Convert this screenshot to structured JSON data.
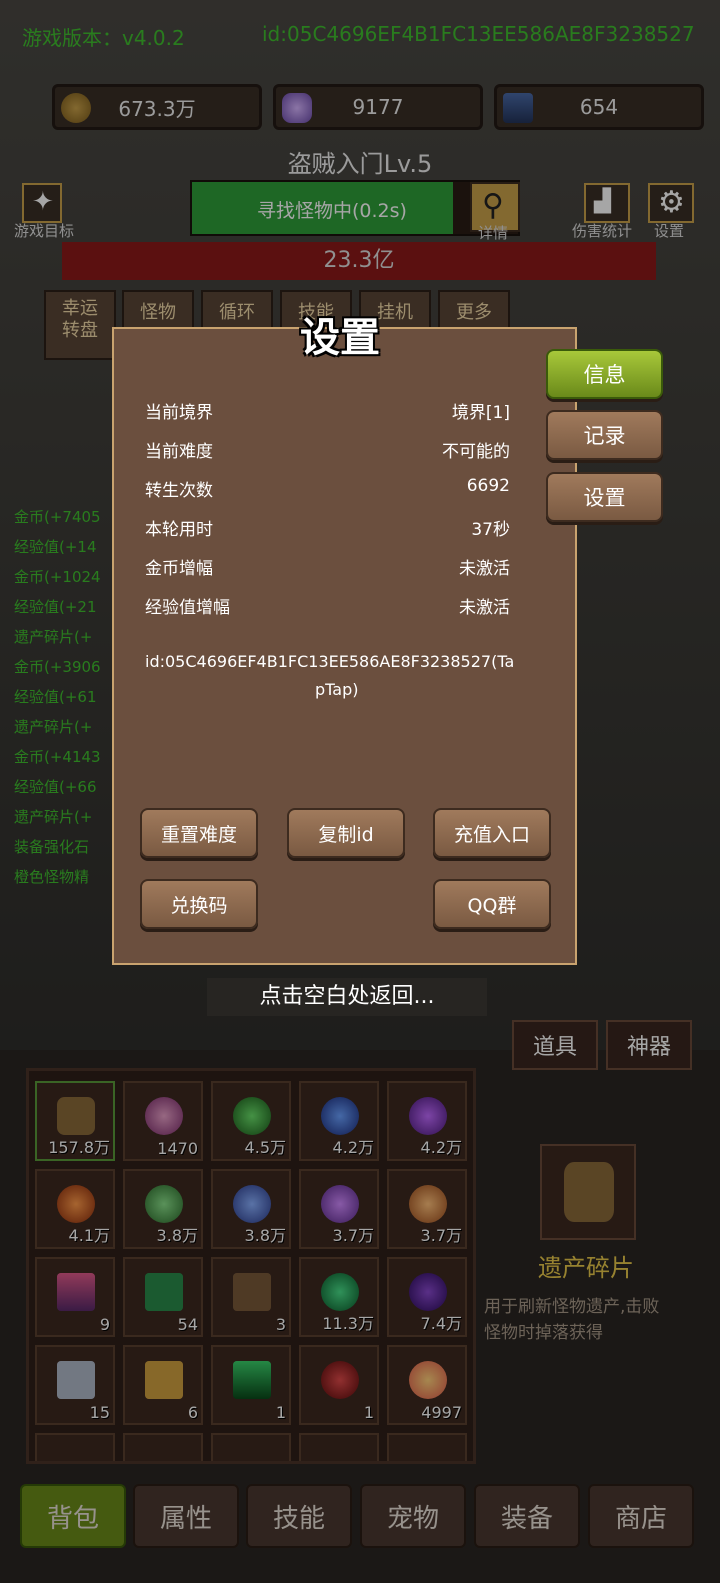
{
  "header": {
    "version_label": "游戏版本：v4.0.2",
    "id_label": "id:05C4696EF4B1FC13EE586AE8F3238527"
  },
  "resources": [
    {
      "icon": "coin-icon",
      "value": "673.3万"
    },
    {
      "icon": "crystal-icon",
      "value": "9177"
    },
    {
      "icon": "card-icon",
      "value": "654"
    }
  ],
  "stage": {
    "title": "盗贼入门Lv.5",
    "progress_text": "寻找怪物中(0.2s)",
    "progress": 0.8,
    "hp_text": "23.3亿"
  },
  "top_buttons": {
    "goal": "游戏目标",
    "detail": "详情",
    "damage": "伤害统计",
    "settings": "设置"
  },
  "small_tabs": [
    "幸运\n转盘",
    "怪物",
    "循环",
    "技能",
    "挂机",
    "更多"
  ],
  "log_lines": [
    "金币(+7405",
    "经验值(+14",
    "金币(+1024",
    "经验值(+21",
    "遗产碎片(+",
    "金币(+3906",
    "经验值(+61",
    "遗产碎片(+",
    "金币(+4143",
    "经验值(+66",
    "遗产碎片(+",
    "装备强化石",
    "橙色怪物精"
  ],
  "dialog": {
    "title": "设置",
    "rows": [
      {
        "label": "当前境界",
        "value": "境界[1]"
      },
      {
        "label": "当前难度",
        "value": "不可能的"
      },
      {
        "label": "转生次数",
        "value": "6692"
      },
      {
        "label": "本轮用时",
        "value": "37秒"
      },
      {
        "label": "金币增幅",
        "value": "未激活"
      },
      {
        "label": "经验值增幅",
        "value": "未激活"
      }
    ],
    "id_line1": "id:05C4696EF4B1FC13EE586AE8F3238527(Ta",
    "id_line2": "pTap)",
    "buttons": {
      "reset": "重置难度",
      "copy": "复制id",
      "recharge": "充值入口",
      "redeem": "兑换码",
      "qq": "QQ群"
    },
    "side_tabs": [
      "信息",
      "记录",
      "设置"
    ],
    "hint": "点击空白处返回..."
  },
  "inventory": {
    "tabs": [
      "道具",
      "神器"
    ],
    "slots": [
      "157.8万",
      "1470",
      "4.5万",
      "4.2万",
      "4.2万",
      "4.1万",
      "3.8万",
      "3.8万",
      "3.7万",
      "3.7万",
      "9",
      "54",
      "3",
      "11.3万",
      "7.4万",
      "15",
      "6",
      "1",
      "1",
      "4997"
    ],
    "detail_title": "遗产碎片",
    "detail_desc1": "用于刷新怪物遗产,击败",
    "detail_desc2": "怪物时掉落获得"
  },
  "bottom_nav": [
    "背包",
    "属性",
    "技能",
    "宠物",
    "装备",
    "商店"
  ],
  "colors": {
    "accent_green": "#3fbf2f",
    "dialog_bg": "#6b4f3e",
    "active_tab": "#8db42a",
    "hp_bar": "#8c1a1a"
  }
}
